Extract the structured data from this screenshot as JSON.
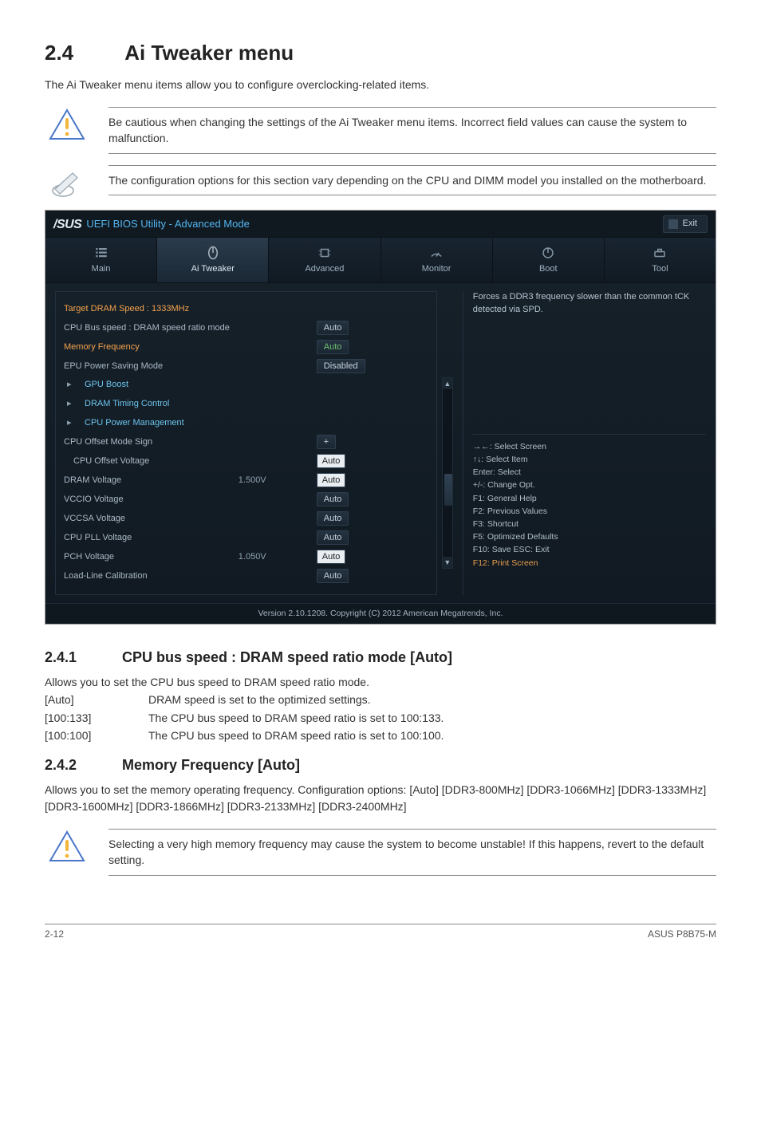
{
  "section": {
    "number": "2.4",
    "title": "Ai Tweaker menu",
    "intro": "The Ai Tweaker menu items allow you to configure overclocking-related items."
  },
  "callouts": {
    "caution1": "Be cautious when changing the settings of the Ai Tweaker menu items. Incorrect field values can cause the system to malfunction.",
    "note1": "The configuration options for this section vary depending on the CPU and DIMM model you installed on the motherboard."
  },
  "bios": {
    "logo": "/SUS",
    "title": "UEFI BIOS Utility - Advanced Mode",
    "exit": "Exit",
    "tabs": {
      "main": "Main",
      "ai_tweaker": "Ai Tweaker",
      "advanced": "Advanced",
      "monitor": "Monitor",
      "boot": "Boot",
      "tool": "Tool"
    },
    "left": {
      "target_dram": "Target DRAM Speed : 1333MHz",
      "cpu_bus_label": "CPU Bus speed : DRAM speed ratio mode",
      "cpu_bus_val": "Auto",
      "mem_freq_label": "Memory Frequency",
      "mem_freq_val": "Auto",
      "epu_label": "EPU Power Saving Mode",
      "epu_val": "Disabled",
      "gpu_boost": "GPU Boost",
      "dram_timing": "DRAM Timing Control",
      "cpu_power_mgmt": "CPU Power Management",
      "offset_sign_label": "CPU Offset Mode Sign",
      "offset_sign_val": "+",
      "offset_volt_label": "CPU Offset Voltage",
      "offset_volt_val": "Auto",
      "dram_volt_label": "DRAM Voltage",
      "dram_volt_mid": "1.500V",
      "dram_volt_val": "Auto",
      "vccio_label": "VCCIO Voltage",
      "vccio_val": "Auto",
      "vccsa_label": "VCCSA Voltage",
      "vccsa_val": "Auto",
      "cpupll_label": "CPU PLL Voltage",
      "cpupll_val": "Auto",
      "pch_label": "PCH Voltage",
      "pch_mid": "1.050V",
      "pch_val": "Auto",
      "llc_label": "Load-Line Calibration",
      "llc_val": "Auto"
    },
    "right": {
      "help": "Forces a DDR3 frequency slower than the common tCK detected via SPD.",
      "k1": "→←: Select Screen",
      "k2": "↑↓: Select Item",
      "k3": "Enter: Select",
      "k4": "+/-: Change Opt.",
      "k5": "F1: General Help",
      "k6": "F2: Previous Values",
      "k7": "F3: Shortcut",
      "k8": "F5: Optimized Defaults",
      "k9": "F10: Save   ESC: Exit",
      "k10": "F12: Print Screen"
    },
    "footer": "Version 2.10.1208.   Copyright (C) 2012 American Megatrends, Inc."
  },
  "sub241": {
    "number": "2.4.1",
    "title": "CPU bus speed : DRAM speed ratio mode [Auto]",
    "intro": "Allows you to set the CPU bus speed to DRAM speed ratio mode.",
    "opts": [
      {
        "k": "[Auto]",
        "v": "DRAM speed is set to the optimized settings."
      },
      {
        "k": "[100:133]",
        "v": "The CPU bus speed to DRAM speed ratio is set to 100:133."
      },
      {
        "k": "[100:100]",
        "v": "The CPU bus speed to DRAM speed ratio is set to 100:100."
      }
    ]
  },
  "sub242": {
    "number": "2.4.2",
    "title": "Memory Frequency [Auto]",
    "body": "Allows you to set the memory operating frequency. Configuration options: [Auto] [DDR3-800MHz] [DDR3-1066MHz] [DDR3-1333MHz] [DDR3-1600MHz] [DDR3-1866MHz] [DDR3-2133MHz] [DDR3-2400MHz]"
  },
  "callout_bottom": "Selecting a very high memory frequency may cause the system to become unstable! If this happens, revert to the default setting.",
  "footer": {
    "left": "2-12",
    "right": "ASUS P8B75-M"
  }
}
